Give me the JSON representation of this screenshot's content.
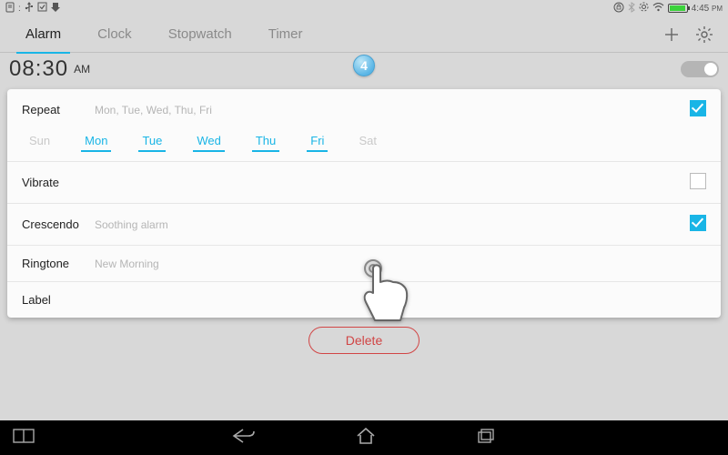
{
  "status": {
    "time": "4:45",
    "time_suffix": "PM"
  },
  "tabs": {
    "items": [
      {
        "label": "Alarm",
        "active": true
      },
      {
        "label": "Clock",
        "active": false
      },
      {
        "label": "Stopwatch",
        "active": false
      },
      {
        "label": "Timer",
        "active": false
      }
    ]
  },
  "alarm": {
    "time": "08:30",
    "ampm": "AM",
    "enabled": false,
    "badge": "4"
  },
  "repeat": {
    "label": "Repeat",
    "summary": "Mon, Tue, Wed, Thu, Fri",
    "checked": true,
    "days": [
      {
        "label": "Sun",
        "selected": false
      },
      {
        "label": "Mon",
        "selected": true
      },
      {
        "label": "Tue",
        "selected": true
      },
      {
        "label": "Wed",
        "selected": true
      },
      {
        "label": "Thu",
        "selected": true
      },
      {
        "label": "Fri",
        "selected": true
      },
      {
        "label": "Sat",
        "selected": false
      }
    ]
  },
  "vibrate": {
    "label": "Vibrate",
    "checked": false
  },
  "crescendo": {
    "label": "Crescendo",
    "value": "Soothing alarm",
    "checked": true
  },
  "ringtone": {
    "label": "Ringtone",
    "value": "New Morning"
  },
  "label_row": {
    "label": "Label"
  },
  "delete_label": "Delete"
}
